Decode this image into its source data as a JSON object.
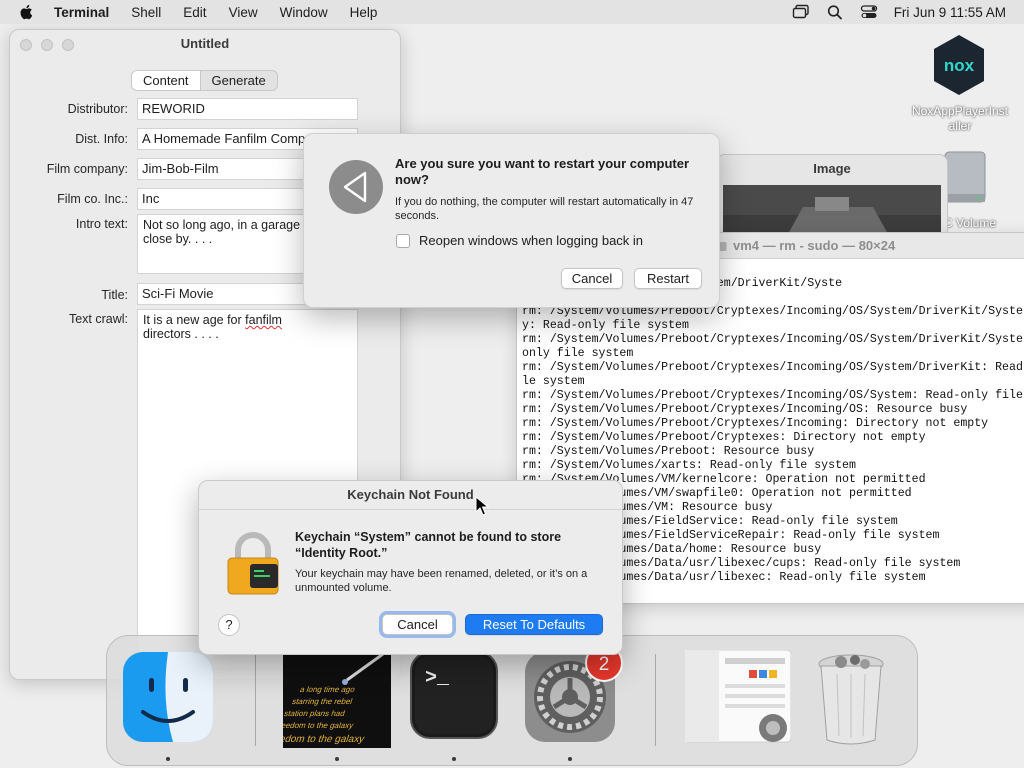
{
  "menubar": {
    "app": "Terminal",
    "items": [
      "Shell",
      "Edit",
      "View",
      "Window",
      "Help"
    ],
    "clock": "Fri Jun 9  11:55 AM"
  },
  "desktop": {
    "nox_label": "NoxAppPlayerInst aller",
    "volume_label": "C Volume"
  },
  "untitled": {
    "title": "Untitled",
    "tabs": [
      "Content",
      "Generate"
    ],
    "fields": {
      "distributor_label": "Distributor:",
      "distributor": "REWORID",
      "dist_info_label": "Dist. Info:",
      "dist_info": "A Homemade Fanfilm Comp",
      "film_company_label": "Film company:",
      "film_company": "Jim-Bob-Film",
      "film_co_inc_label": "Film co. Inc.:",
      "film_co_inc": "Inc",
      "intro_label": "Intro text:",
      "intro_line1": "Not so long ago, in a garage p",
      "intro_line2": "close by. . . .",
      "title_label": "Title:",
      "title": "Sci-Fi Movie",
      "crawl_label": "Text crawl:",
      "crawl_line1_a": "It is a new age for ",
      "crawl_line1_b": "fanfilm",
      "crawl_line2": "directors . . . ."
    }
  },
  "image_window": {
    "title": "Image"
  },
  "terminal": {
    "title": "vm4 — rm - sudo — 80×24",
    "lines": [
      "  _64: Read-only file system",
      "  Cryptexes/Incoming/OS/System/DriverKit/Syste",
      "  m",
      "rm: /System/Volumes/Preboot/Cryptexes/Incoming/OS/System/DriverKit/Syste",
      "y: Read-only file system",
      "rm: /System/Volumes/Preboot/Cryptexes/Incoming/OS/System/DriverKit/Syste",
      "only file system",
      "rm: /System/Volumes/Preboot/Cryptexes/Incoming/OS/System/DriverKit: Read",
      "le system",
      "rm: /System/Volumes/Preboot/Cryptexes/Incoming/OS/System: Read-only file",
      "rm: /System/Volumes/Preboot/Cryptexes/Incoming/OS: Resource busy",
      "rm: /System/Volumes/Preboot/Cryptexes/Incoming: Directory not empty",
      "rm: /System/Volumes/Preboot/Cryptexes: Directory not empty",
      "rm: /System/Volumes/Preboot: Resource busy",
      "rm: /System/Volumes/xarts: Read-only file system",
      "rm: /System/Volumes/VM/kernelcore: Operation not permitted",
      "              umes/VM/swapfile0: Operation not permitted",
      "              umes/VM: Resource busy",
      "              umes/FieldService: Read-only file system",
      "              umes/FieldServiceRepair: Read-only file system",
      "              umes/Data/home: Resource busy",
      "              umes/Data/usr/libexec/cups: Read-only file system",
      "              umes/Data/usr/libexec: Read-only file system"
    ]
  },
  "restart_dialog": {
    "heading": "Are you sure you want to restart your computer now?",
    "message": "If you do nothing, the computer will restart automatically in 47 seconds.",
    "checkbox_label": "Reopen windows when logging back in",
    "cancel": "Cancel",
    "restart": "Restart"
  },
  "keychain_dialog": {
    "title": "Keychain Not Found",
    "heading": "Keychain “System” cannot be found to store “Identity Root.”",
    "message": "Your keychain may have been renamed, deleted, or it’s on a unmounted volume.",
    "help": "?",
    "cancel": "Cancel",
    "reset": "Reset To Defaults"
  },
  "dock": {
    "settings_badge": "2",
    "terminal_prompt": ">_"
  },
  "colors": {
    "accent": "#1f7bf2",
    "badge": "#e8372c"
  }
}
